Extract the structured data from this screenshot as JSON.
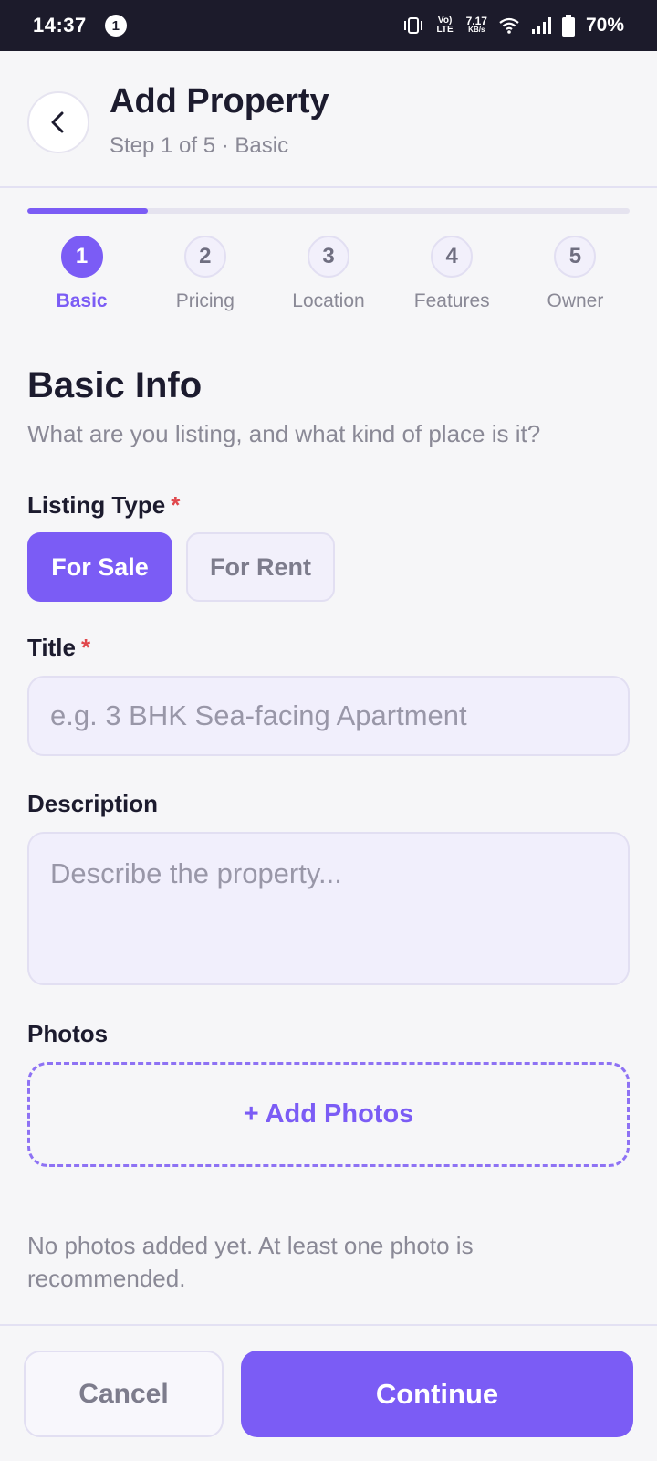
{
  "status_bar": {
    "time": "14:37",
    "notification_count": "1",
    "volte": "Vo) LTE",
    "net_speed_value": "7.17",
    "net_speed_unit": "KB/s",
    "battery": "70%",
    "icons": [
      "vibrate-icon",
      "volte-icon",
      "wifi-icon",
      "signal-icon",
      "battery-icon"
    ]
  },
  "header": {
    "title": "Add Property",
    "subtitle": "Step 1 of 5 · Basic",
    "back_icon": "chevron-left-icon"
  },
  "progress": {
    "current_step": 1,
    "total_steps": 5,
    "fraction": 0.2
  },
  "steps": [
    {
      "number": "1",
      "label": "Basic",
      "active": true
    },
    {
      "number": "2",
      "label": "Pricing",
      "active": false
    },
    {
      "number": "3",
      "label": "Location",
      "active": false
    },
    {
      "number": "4",
      "label": "Features",
      "active": false
    },
    {
      "number": "5",
      "label": "Owner",
      "active": false
    }
  ],
  "section": {
    "title": "Basic Info",
    "description": "What are you listing, and what kind of place is it?"
  },
  "listing_type": {
    "label": "Listing Type",
    "required_mark": "*",
    "options": [
      "For Sale",
      "For Rent"
    ],
    "selected": "For Sale"
  },
  "title_field": {
    "label": "Title",
    "required_mark": "*",
    "value": "",
    "placeholder": "e.g. 3 BHK Sea-facing Apartment"
  },
  "description_field": {
    "label": "Description",
    "value": "",
    "placeholder": "Describe the property..."
  },
  "photos": {
    "label": "Photos",
    "add_label": "+ Add Photos",
    "empty_note": "No photos added yet. At least one photo is recommended."
  },
  "footer": {
    "cancel_label": "Cancel",
    "continue_label": "Continue"
  },
  "colors": {
    "accent": "#7b5cf5",
    "required": "#e0474c",
    "status_bar": "#1c1b2b",
    "background": "#f6f6f8"
  }
}
